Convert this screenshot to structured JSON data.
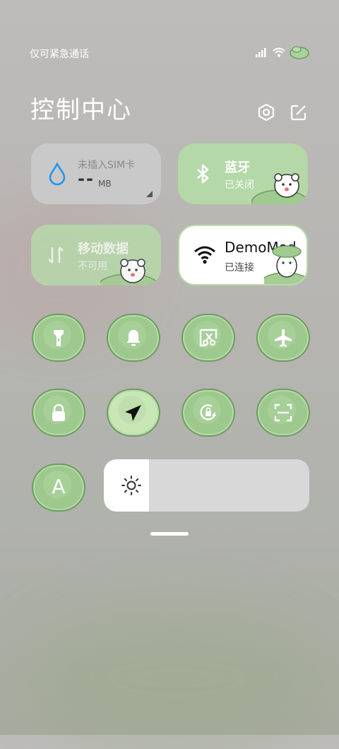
{
  "status_bar": {
    "carrier_text": "仅可紧急通话",
    "icons": [
      "signal-icon",
      "wifi-icon",
      "battery-icon"
    ]
  },
  "header": {
    "title": "控制中心",
    "icons": [
      "settings-icon",
      "edit-icon"
    ]
  },
  "tiles": {
    "data_usage": {
      "label": "未插入SIM卡",
      "value": "--",
      "unit": "MB"
    },
    "bluetooth": {
      "label": "蓝牙",
      "status": "已关闭"
    },
    "mobile_data": {
      "label": "移动数据",
      "status": "不可用"
    },
    "wifi": {
      "label": "DemoMod",
      "status": "已连接"
    }
  },
  "toggles_row1": [
    "flashlight-icon",
    "bell-icon",
    "screenshot-icon",
    "airplane-icon"
  ],
  "toggles_row2": [
    "lock-icon",
    "location-icon",
    "rotation-lock-icon",
    "scanner-icon"
  ],
  "toggles_row3": [
    "font-icon"
  ],
  "auto_brightness_label": "A",
  "brightness": {
    "level": 0.22
  },
  "colors": {
    "accent_green": "#b4d8a7",
    "tile_gray": "#c9c9c9",
    "wifi_tile_white": "#ffffff",
    "data_blue": "#2196f3"
  }
}
